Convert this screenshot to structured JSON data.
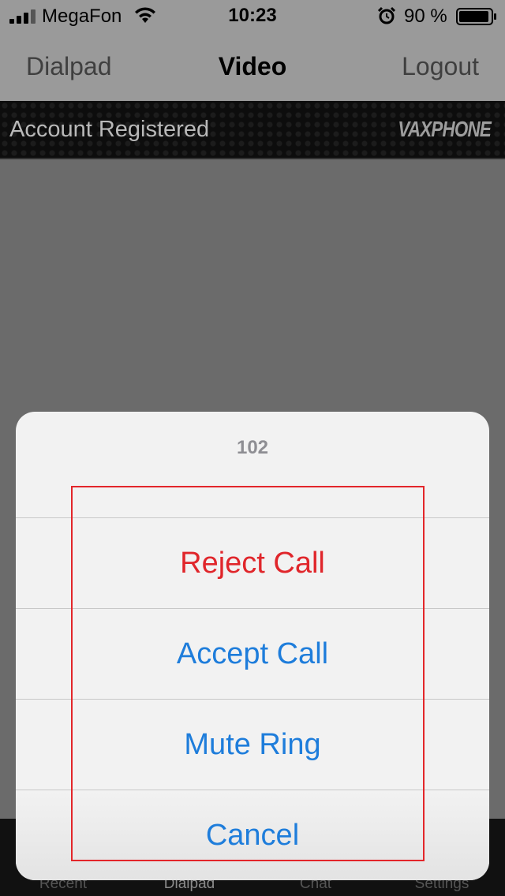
{
  "status_bar": {
    "carrier": "MegaFon",
    "time": "10:23",
    "battery": "90 %"
  },
  "nav": {
    "left": "Dialpad",
    "title": "Video",
    "right": "Logout"
  },
  "banner": {
    "status": "Account Registered",
    "brand": "VAXPHONE"
  },
  "sheet": {
    "title": "102",
    "buttons": [
      {
        "label": "Reject Call"
      },
      {
        "label": "Accept Call"
      },
      {
        "label": "Mute Ring"
      },
      {
        "label": "Cancel"
      }
    ]
  },
  "tabs": [
    {
      "label": "Recent"
    },
    {
      "label": "Dialpad"
    },
    {
      "label": "Chat"
    },
    {
      "label": "Settings"
    }
  ],
  "colors": {
    "destructive": "#e0262b",
    "action": "#1e7ddb",
    "highlight": "#e3262a"
  }
}
